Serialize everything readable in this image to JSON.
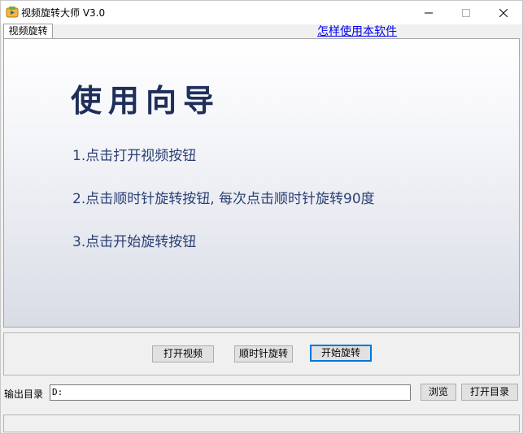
{
  "window": {
    "title": "视频旋转大师 V3.0",
    "icons": {
      "app": "video-app-icon",
      "minimize": "minimize-icon",
      "maximize": "maximize-icon",
      "close": "close-icon"
    }
  },
  "tabs": [
    {
      "label": "视频旋转",
      "active": true
    }
  ],
  "help_link": "怎样使用本软件",
  "guide": {
    "title": "使用向导",
    "steps": [
      "1.点击打开视频按钮",
      "2.点击顺时针旋转按钮, 每次点击顺时针旋转90度",
      "3.点击开始旋转按钮"
    ]
  },
  "controls": {
    "open_video": "打开视频",
    "rotate_cw": "顺时针旋转",
    "start_rotate": "开始旋转"
  },
  "output": {
    "label": "输出目录",
    "value": "D:",
    "browse": "浏览",
    "open_dir": "打开目录"
  },
  "colors": {
    "title_accent": "#1f2f5a",
    "step_text": "#2a3f73",
    "link": "#0000ee",
    "focus_border": "#0078d7"
  }
}
